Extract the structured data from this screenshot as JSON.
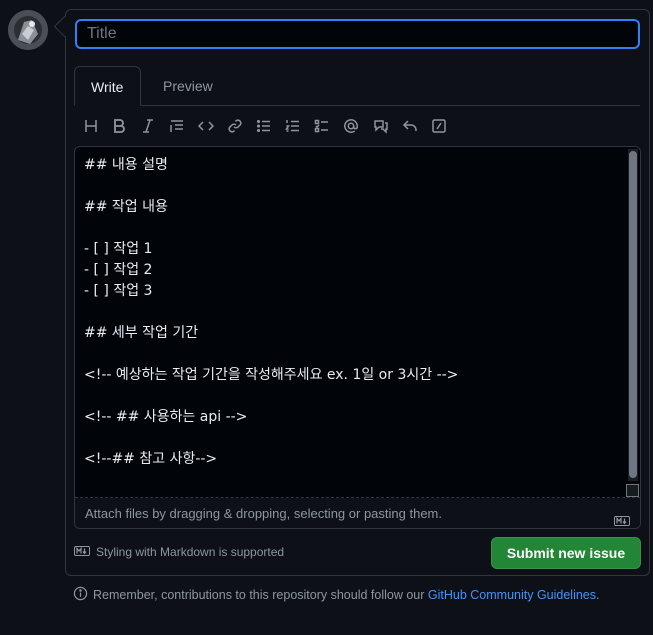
{
  "title_input": {
    "placeholder": "Title",
    "value": ""
  },
  "tabs": [
    {
      "label": "Write"
    },
    {
      "label": "Preview"
    }
  ],
  "toolbar": {
    "icons": [
      "heading-icon",
      "bold-icon",
      "italic-icon",
      "quote-icon",
      "code-icon",
      "link-icon",
      "bulleted-list-icon",
      "numbered-list-icon",
      "task-list-icon",
      "mention-icon",
      "cross-reference-icon",
      "reply-icon",
      "slash-commands-icon"
    ]
  },
  "editor": {
    "lines": [
      "## 내용 설명",
      "",
      "## 작업 내용",
      "",
      "- [ ] 작업 1",
      "- [ ] 작업 2",
      "- [ ] 작업 3",
      "",
      "## 세부 작업 기간",
      "",
      "<!-- 예상하는 작업 기간을 작성해주세요 ex. 1일 or 3시간 -->",
      "",
      "<!-- ## 사용하는 api -->",
      "",
      "<!--## 참고 사항-->"
    ]
  },
  "attach_hint": "Attach files by dragging & dropping, selecting or pasting them.",
  "markdown_note": "Styling with Markdown is supported",
  "submit_label": "Submit new issue",
  "footer": {
    "prefix": "Remember, contributions to this repository should follow our ",
    "link": "GitHub Community Guidelines",
    "suffix": "."
  },
  "colors": {
    "accent": "#2f81f7",
    "submit": "#238636",
    "link": "#4493f8",
    "background": "#0d1117"
  }
}
